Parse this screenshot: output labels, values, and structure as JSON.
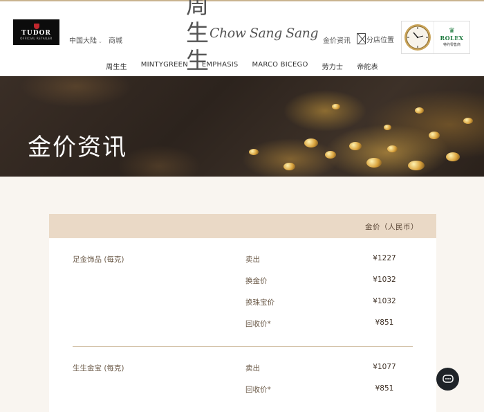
{
  "header": {
    "tudor": {
      "name": "TUDOR",
      "tag": "OFFICIAL RETAILER"
    },
    "region": "中国大陆",
    "mall": "商城",
    "brand_cn": "周生生",
    "brand_en": "Chow Sang Sang",
    "gold_price_link": "金价资讯",
    "store_locator": "分店位置",
    "rolex": {
      "name": "ROLEX",
      "tag": "特约零售商"
    }
  },
  "nav": [
    "周生生",
    "MINTYGREEN",
    "EMPHASIS",
    "MARCO BICEGO",
    "劳力士",
    "帝舵表"
  ],
  "hero": {
    "title": "金价资讯"
  },
  "table": {
    "column_header": "金价（人民币）",
    "groups": [
      {
        "name": "足金饰品 (每克)",
        "rows": [
          {
            "type": "卖出",
            "price": "¥1227"
          },
          {
            "type": "换金价",
            "price": "¥1032"
          },
          {
            "type": "换珠宝价",
            "price": "¥1032"
          },
          {
            "type": "回收价*",
            "price": "¥851"
          }
        ]
      },
      {
        "name": "生生金宝 (每克)",
        "rows": [
          {
            "type": "卖出",
            "price": "¥1077"
          },
          {
            "type": "回收价*",
            "price": "¥851"
          }
        ]
      }
    ]
  },
  "icons": {
    "store": "broken-image-icon",
    "chat": "chat-icon"
  },
  "colors": {
    "accent": "#c9b38f",
    "table_head": "#ead9c6",
    "page_bg": "#f9f5f0",
    "rolex_green": "#1e7a3f"
  }
}
